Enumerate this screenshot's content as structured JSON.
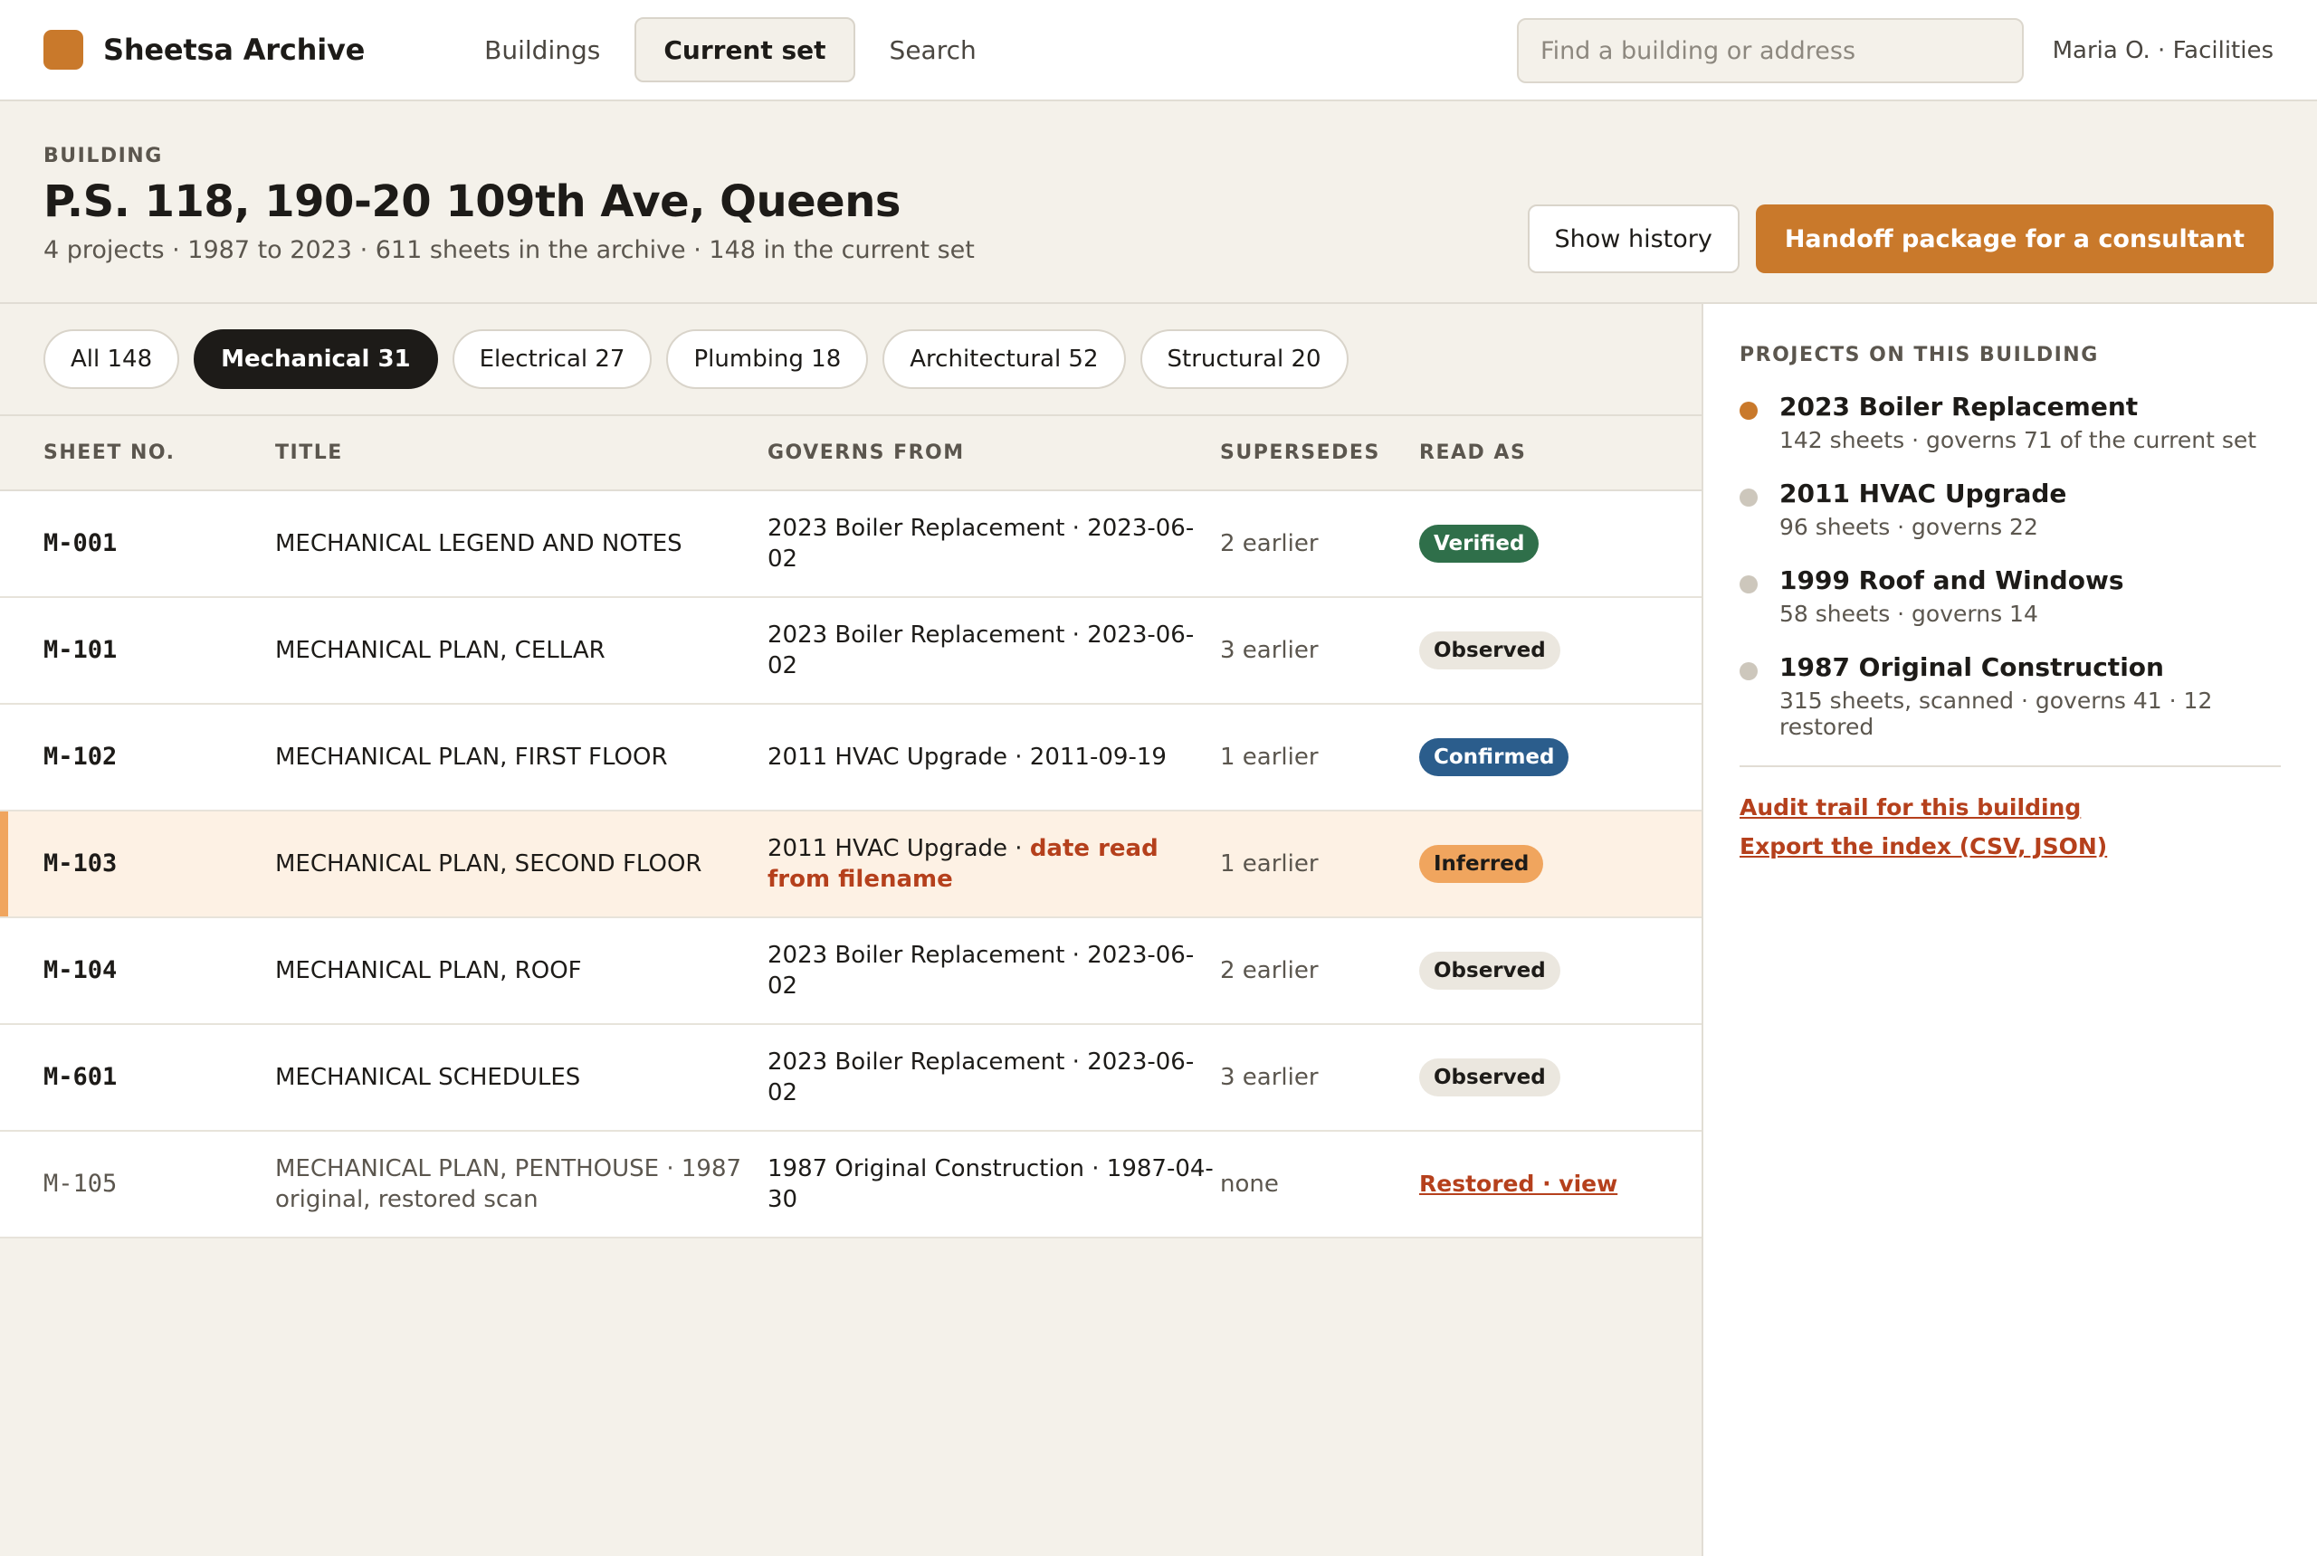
{
  "app": {
    "name": "Sheetsa Archive"
  },
  "nav": {
    "items": [
      "Buildings",
      "Current set",
      "Search"
    ],
    "active": "Current set"
  },
  "search": {
    "placeholder": "Find a building or address",
    "value": ""
  },
  "user": {
    "label": "Maria O. · Facilities"
  },
  "building": {
    "kicker": "BUILDING",
    "title": "P.S. 118, 190-20 109th Ave, Queens",
    "summary": "4 projects · 1987 to 2023 · 611 sheets in the archive · 148 in the current set"
  },
  "actions": {
    "history": "Show history",
    "handoff": "Handoff package for a consultant"
  },
  "filters": [
    {
      "label": "All 148",
      "active": false
    },
    {
      "label": "Mechanical 31",
      "active": true
    },
    {
      "label": "Electrical 27",
      "active": false
    },
    {
      "label": "Plumbing 18",
      "active": false
    },
    {
      "label": "Architectural 52",
      "active": false
    },
    {
      "label": "Structural 20",
      "active": false
    }
  ],
  "table": {
    "columns": [
      "SHEET NO.",
      "TITLE",
      "GOVERNS FROM",
      "SUPERSEDES",
      "READ AS"
    ],
    "rows": [
      {
        "no": "M-001",
        "title": "MECHANICAL LEGEND AND NOTES",
        "governs": "2023 Boiler Replacement · 2023-06-02",
        "supersedes": "2 earlier",
        "read_as": "Verified"
      },
      {
        "no": "M-101",
        "title": "MECHANICAL PLAN, CELLAR",
        "governs": "2023 Boiler Replacement · 2023-06-02",
        "supersedes": "3 earlier",
        "read_as": "Observed"
      },
      {
        "no": "M-102",
        "title": "MECHANICAL PLAN, FIRST FLOOR",
        "governs": "2011 HVAC Upgrade · 2011-09-19",
        "supersedes": "1 earlier",
        "read_as": "Confirmed"
      },
      {
        "no": "M-103",
        "title": "MECHANICAL PLAN, SECOND FLOOR",
        "governs": "2011 HVAC Upgrade · ",
        "governs_note": "date read from filename",
        "supersedes": "1 earlier",
        "read_as": "Inferred"
      },
      {
        "no": "M-104",
        "title": "MECHANICAL PLAN, ROOF",
        "governs": "2023 Boiler Replacement · 2023-06-02",
        "supersedes": "2 earlier",
        "read_as": "Observed"
      },
      {
        "no": "M-601",
        "title": "MECHANICAL SCHEDULES",
        "governs": "2023 Boiler Replacement · 2023-06-02",
        "supersedes": "3 earlier",
        "read_as": "Observed"
      },
      {
        "no": "M-105",
        "title": "MECHANICAL PLAN, PENTHOUSE · 1987 original, restored scan",
        "governs": "1987 Original Construction · 1987-04-30",
        "supersedes": "none",
        "read_as": "Restored · view"
      }
    ]
  },
  "sidebar": {
    "heading": "PROJECTS ON THIS BUILDING",
    "projects": [
      {
        "name": "2023 Boiler Replacement",
        "meta": "142 sheets · governs 71 of the current set",
        "active": true
      },
      {
        "name": "2011 HVAC Upgrade",
        "meta": "96 sheets · governs 22",
        "active": false
      },
      {
        "name": "1999 Roof and Windows",
        "meta": "58 sheets · governs 14",
        "active": false
      },
      {
        "name": "1987 Original Construction",
        "meta": "315 sheets, scanned · governs 41 · 12 restored",
        "active": false
      }
    ],
    "links": [
      "Audit trail for this building",
      "Export the index (CSV, JSON)"
    ]
  },
  "colors": {
    "accent": "#c9792b",
    "verified": "#2f6f4a",
    "confirmed": "#2b5d8c",
    "inferred": "#f0a55e",
    "warning_text": "#b5401c"
  }
}
